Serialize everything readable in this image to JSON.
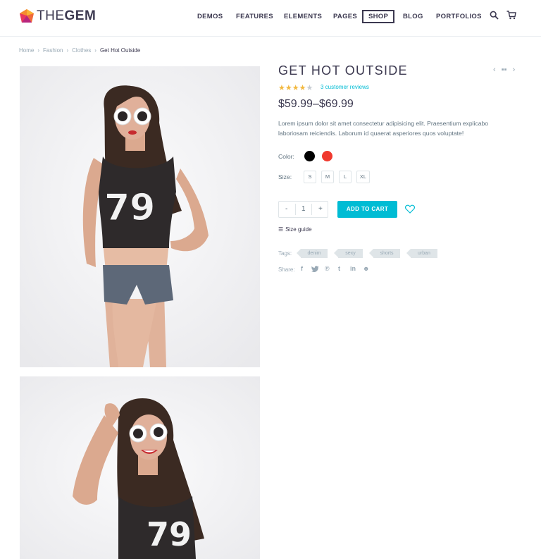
{
  "brand": {
    "name_light": "THE",
    "name_bold": "GEM"
  },
  "nav": {
    "items": [
      "DEMOS",
      "FEATURES",
      "ELEMENTS",
      "PAGES",
      "SHOP",
      "BLOG",
      "PORTFOLIOS"
    ],
    "active": "SHOP"
  },
  "breadcrumb": [
    "Home",
    "Fashion",
    "Clothes",
    "Get Hot Outside"
  ],
  "product": {
    "title": "GET HOT OUTSIDE",
    "rating": 4,
    "rating_max": 5,
    "reviews_label": "3 customer reviews",
    "price": "$59.99–$69.99",
    "description": "Lorem ipsum dolor sit amet consectetur adipisicing elit. Praesentium explicabo laboriosam reiciendis. Laborum id quaerat asperiores quos voluptate!",
    "color_label": "Color:",
    "colors": [
      "#000000",
      "#f0392e"
    ],
    "size_label": "Size:",
    "sizes": [
      "S",
      "M",
      "L",
      "XL"
    ],
    "quantity": "1",
    "qty_minus": "-",
    "qty_plus": "+",
    "add_to_cart": "ADD TO CART",
    "size_guide": "Size guide",
    "tags_label": "Tags:",
    "tags": [
      "denim",
      "sexy",
      "shorts",
      "urban"
    ],
    "share_label": "Share:"
  },
  "colors": {
    "accent": "#00bcd4",
    "text": "#3c3950",
    "muted": "#99a9b5",
    "star": "#f2b83f"
  }
}
